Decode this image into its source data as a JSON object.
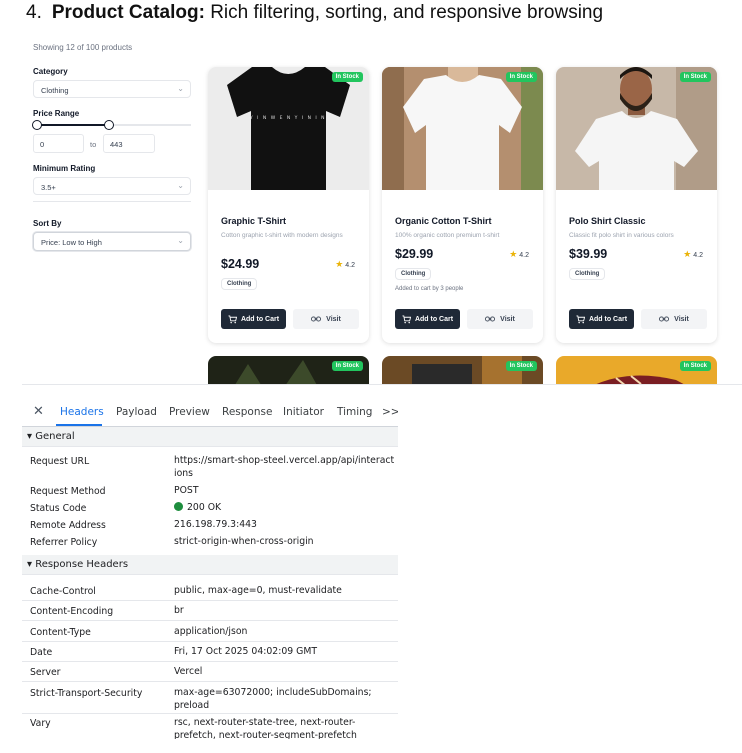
{
  "heading": {
    "number": "4.",
    "bold": "Product Catalog:",
    "rest": "Rich filtering, sorting, and responsive browsing"
  },
  "catalog": {
    "showing": "Showing 12 of 100 products",
    "filters": {
      "category_label": "Category",
      "category_value": "Clothing",
      "price_label": "Price Range",
      "price_min": "0",
      "price_to": "to",
      "price_max": "443",
      "price_range_fraction": [
        0,
        0.47
      ],
      "rating_label": "Minimum Rating",
      "rating_value": "3.5+",
      "sort_label": "Sort By",
      "sort_value": "Price: Low to High"
    },
    "products": [
      {
        "badge": "In Stock",
        "name": "Graphic T-Shirt",
        "desc": "Cotton graphic t-shirt with modern designs",
        "price": "$24.99",
        "rating": "4.2",
        "category": "Clothing",
        "note": "",
        "cart": "Add to Cart",
        "visit": "Visit",
        "shirt_color": "#111111",
        "bg_color": "#ececec"
      },
      {
        "badge": "In Stock",
        "name": "Organic Cotton T-Shirt",
        "desc": "100% organic cotton premium t-shirt",
        "price": "$29.99",
        "rating": "4.2",
        "category": "Clothing",
        "note": "Added to cart by 3 people",
        "cart": "Add to Cart",
        "visit": "Visit",
        "shirt_color": "#f7f7f7",
        "bg_color": "#b48f6f"
      },
      {
        "badge": "In Stock",
        "name": "Polo Shirt Classic",
        "desc": "Classic fit polo shirt in various colors",
        "price": "$39.99",
        "rating": "4.2",
        "category": "Clothing",
        "note": "",
        "cart": "Add to Cart",
        "visit": "Visit",
        "shirt_color": "#f5f5f5",
        "bg_color": "#c7b8a8"
      }
    ],
    "second_row": [
      {
        "badge": "In Stock",
        "bg_color": "#1f2317"
      },
      {
        "badge": "In Stock",
        "bg_color": "#6b4a25"
      },
      {
        "badge": "In Stock",
        "bg_color": "#e9a92a"
      }
    ]
  },
  "devtools": {
    "tabs": [
      "Headers",
      "Payload",
      "Preview",
      "Response",
      "Initiator",
      "Timing"
    ],
    "more": ">>",
    "general_title": "▾ General",
    "general": [
      {
        "key": "Request URL",
        "value": "https://smart-shop-steel.vercel.app/api/interactions"
      },
      {
        "key": "Request Method",
        "value": "POST"
      },
      {
        "key": "Status Code",
        "value": "200 OK"
      },
      {
        "key": "Remote Address",
        "value": "216.198.79.3:443"
      },
      {
        "key": "Referrer Policy",
        "value": "strict-origin-when-cross-origin"
      }
    ],
    "response_title": "▾ Response Headers",
    "response": [
      {
        "key": "Cache-Control",
        "value": "public, max-age=0, must-revalidate"
      },
      {
        "key": "Content-Encoding",
        "value": "br"
      },
      {
        "key": "Content-Type",
        "value": "application/json"
      },
      {
        "key": "Date",
        "value": "Fri, 17 Oct 2025 04:02:09 GMT"
      },
      {
        "key": "Server",
        "value": "Vercel"
      },
      {
        "key": "Strict-Transport-Security",
        "value": "max-age=63072000; includeSubDomains; preload"
      },
      {
        "key": "Vary",
        "value": "rsc, next-router-state-tree, next-router-prefetch, next-router-segment-prefetch"
      }
    ],
    "status_color": "#1e8e3e"
  }
}
